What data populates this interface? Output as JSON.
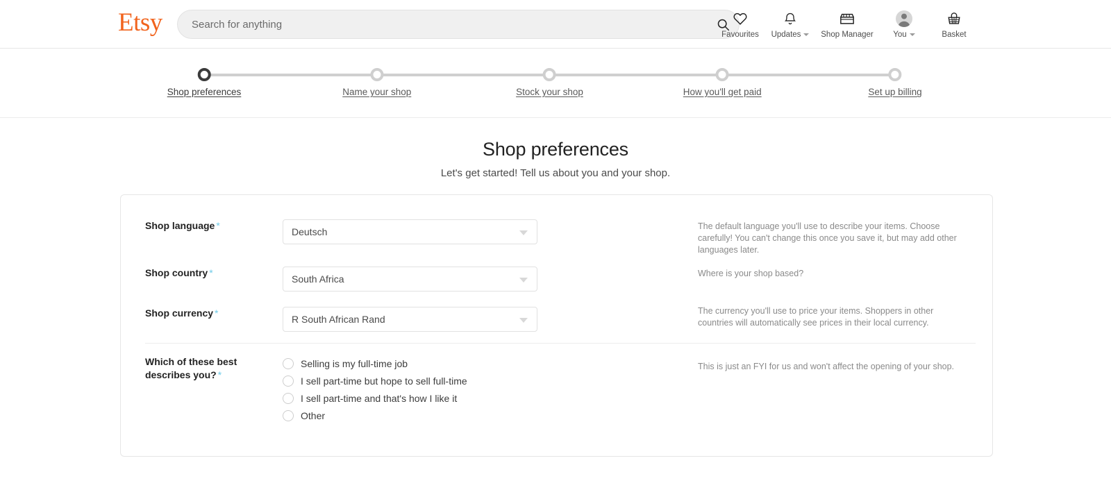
{
  "header": {
    "logo_text": "Etsy",
    "logo_color": "#f1641e",
    "search": {
      "placeholder": "Search for anything",
      "value": "",
      "icon": "search-icon"
    },
    "nav": [
      {
        "label": "Favourites",
        "icon": "heart-icon",
        "caret": false
      },
      {
        "label": "Updates",
        "icon": "bell-icon",
        "caret": true
      },
      {
        "label": "Shop Manager",
        "icon": "storefront-icon",
        "caret": false
      },
      {
        "label": "You",
        "icon": "avatar-icon",
        "caret": true
      },
      {
        "label": "Basket",
        "icon": "basket-icon",
        "caret": false
      }
    ]
  },
  "stepper": {
    "active_index": 0,
    "steps": [
      {
        "label": "Shop preferences"
      },
      {
        "label": "Name your shop"
      },
      {
        "label": "Stock your shop"
      },
      {
        "label": "How you'll get paid"
      },
      {
        "label": "Set up billing"
      }
    ]
  },
  "page": {
    "title": "Shop preferences",
    "subtitle": "Let's get started! Tell us about you and your shop."
  },
  "form": {
    "required_marker": "*",
    "fields": [
      {
        "label": "Shop language",
        "value": "Deutsch",
        "help": "The default language you'll use to describe your items. Choose carefully! You can't change this once you save it, but may add other languages later."
      },
      {
        "label": "Shop country",
        "value": "South Africa",
        "help": "Where is your shop based?"
      },
      {
        "label": "Shop currency",
        "value": "R South African Rand",
        "help": "The currency you'll use to price your items. Shoppers in other countries will automatically see prices in their local currency."
      }
    ],
    "radio_group": {
      "label_line1": "Which of these best",
      "label_line2": "describes you?",
      "help": "This is just an FYI for us and won't affect the opening of your shop.",
      "selected": null,
      "options": [
        {
          "label": "Selling is my full-time job"
        },
        {
          "label": "I sell part-time but hope to sell full-time"
        },
        {
          "label": "I sell part-time and that's how I like it"
        },
        {
          "label": "Other"
        }
      ]
    }
  }
}
